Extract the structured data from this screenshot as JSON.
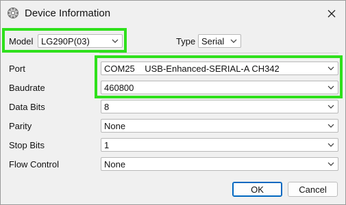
{
  "window": {
    "title": "Device Information"
  },
  "model": {
    "label": "Model",
    "value": "LG290P(03)"
  },
  "type": {
    "label": "Type",
    "value": "Serial"
  },
  "port": {
    "label": "Port",
    "value": "COM25    USB-Enhanced-SERIAL-A CH342"
  },
  "baudrate": {
    "label": "Baudrate",
    "value": "460800"
  },
  "data_bits": {
    "label": "Data Bits",
    "value": "8"
  },
  "parity": {
    "label": "Parity",
    "value": "None"
  },
  "stop_bits": {
    "label": "Stop Bits",
    "value": "1"
  },
  "flow_control": {
    "label": "Flow Control",
    "value": "None"
  },
  "buttons": {
    "ok": "OK",
    "cancel": "Cancel"
  },
  "icons": {
    "app": "gear-icon",
    "close": "close-icon",
    "dropdown": "chevron-down-icon"
  },
  "colors": {
    "highlight": "#2fe01c",
    "ok_border": "#0067c0"
  }
}
